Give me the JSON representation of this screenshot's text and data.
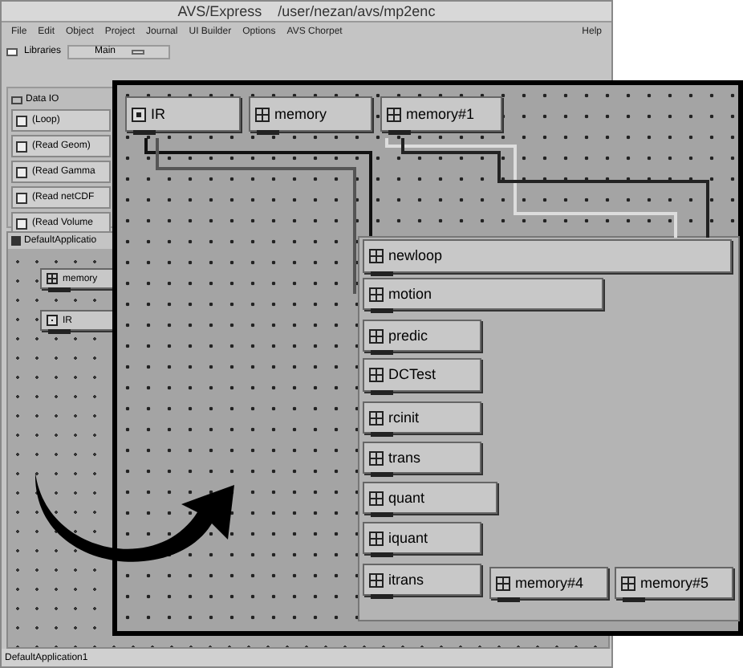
{
  "window": {
    "title": "AVS/Express    /user/nezan/avs/mp2enc"
  },
  "menu": [
    {
      "label": "File"
    },
    {
      "label": "Edit"
    },
    {
      "label": "Object"
    },
    {
      "label": "Project"
    },
    {
      "label": "Journal"
    },
    {
      "label": "UI Builder"
    },
    {
      "label": "Options"
    },
    {
      "label": "AVS Chorpet"
    },
    {
      "label": "Help"
    }
  ],
  "toolbar": {
    "libraries": {
      "label": "Libraries",
      "checked": false
    },
    "library_select": {
      "value": "Main"
    }
  },
  "library": {
    "title": "Data IO",
    "items": [
      "(Loop)",
      "(Read Geom)",
      "(Read Gamma",
      "(Read netCDF",
      "(Read Volume"
    ]
  },
  "network": {
    "title": "DefaultApplicatio",
    "nodes": [
      {
        "label": "memory",
        "kind": "module"
      },
      {
        "label": "IR",
        "kind": "reader"
      }
    ]
  },
  "zoomed_network": {
    "nodes": [
      {
        "label": "IR",
        "kind": "reader"
      },
      {
        "label": "memory",
        "kind": "module"
      },
      {
        "label": "memory#1",
        "kind": "module"
      },
      {
        "label": "newloop",
        "kind": "module"
      },
      {
        "label": "motion",
        "kind": "module"
      },
      {
        "label": "predic",
        "kind": "module"
      },
      {
        "label": "DCTest",
        "kind": "module"
      },
      {
        "label": "rcinit",
        "kind": "module"
      },
      {
        "label": "trans",
        "kind": "module"
      },
      {
        "label": "quant",
        "kind": "module"
      },
      {
        "label": "iquant",
        "kind": "module"
      },
      {
        "label": "itrans",
        "kind": "module"
      },
      {
        "label": "memory#4",
        "kind": "module"
      },
      {
        "label": "memory#5",
        "kind": "module"
      }
    ]
  },
  "status_bar": "DefaultApplication1"
}
